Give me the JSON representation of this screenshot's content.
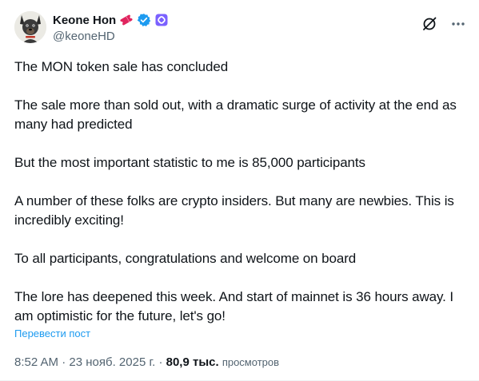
{
  "author": {
    "display_name": "Keone Hon",
    "handle": "@keoneHD",
    "avatar": "dog-avatar",
    "badges": [
      "ticket-emoji",
      "verified-badge",
      "affiliate-badge"
    ]
  },
  "header_actions": [
    "grok-icon",
    "more-icon"
  ],
  "post": {
    "paragraphs": [
      "The MON token sale has concluded",
      "The sale more than sold out, with a dramatic surge of activity at the end as many had predicted",
      "But the most important statistic to me is 85,000 participants",
      "A number of these folks are crypto insiders. But many are newbies. This is incredibly exciting!",
      "To all participants, congratulations and welcome on board",
      "The lore has deepened this week. And start of mainnet is 36 hours away. I am optimistic for the future, let's go!"
    ],
    "translate_label": "Перевести пост"
  },
  "meta": {
    "time": "8:52 AM",
    "date": "23 нояб. 2025 г.",
    "separator": "·",
    "views_count": "80,9 тыс.",
    "views_label": "просмотров"
  },
  "colors": {
    "text": "#0f1419",
    "secondary": "#536471",
    "link": "#1d9bf0",
    "verified": "#1d9bf0",
    "affiliate": "#7b61ff",
    "ticket": "#e0245e"
  }
}
